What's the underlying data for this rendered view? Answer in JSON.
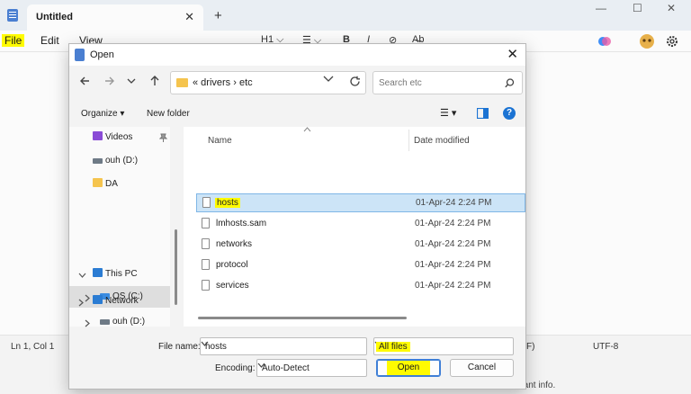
{
  "notepad": {
    "tab_title": "Untitled",
    "tab_close": "✕",
    "tab_add": "+",
    "window_controls": {
      "minimize": "—",
      "maximize": "☐",
      "close": "✕"
    },
    "menu": {
      "file": "File",
      "edit": "Edit",
      "view": "View"
    },
    "format_bar": {
      "heading": "H1 ⌵",
      "list": "☰ ⌵",
      "bold": "B",
      "italic": "I",
      "link": "⊘",
      "clear": "A̶b"
    },
    "status": {
      "position": "Ln 1, Col 1",
      "line_ending": "F)",
      "encoding": "UTF-8"
    },
    "info_text": "ortant info."
  },
  "dialog": {
    "title": "Open",
    "close": "✕",
    "address": {
      "path": "«  drivers  ›  etc"
    },
    "search": {
      "placeholder": "Search etc"
    },
    "toolbar": {
      "organize": "Organize ▾",
      "new_folder": "New folder",
      "view_toggle": "☰ ▾",
      "help": "?"
    },
    "nav_pane": {
      "videos": "Videos",
      "ouh_d_1": "ouh (D:)",
      "da": "DA",
      "this_pc": "This PC",
      "os_c": "OS (C:)",
      "ouh_d_2": "ouh (D:)",
      "network": "Network"
    },
    "columns": {
      "name": "Name",
      "date_modified": "Date modified"
    },
    "files": [
      {
        "name": "hosts",
        "date": "01-Apr-24 2:24 PM"
      },
      {
        "name": "lmhosts.sam",
        "date": "01-Apr-24 2:24 PM"
      },
      {
        "name": "networks",
        "date": "01-Apr-24 2:24 PM"
      },
      {
        "name": "protocol",
        "date": "01-Apr-24 2:24 PM"
      },
      {
        "name": "services",
        "date": "01-Apr-24 2:24 PM"
      }
    ],
    "bottom": {
      "file_name_label": "File name:",
      "file_name_value": "hosts",
      "filter_value": "All files",
      "encoding_label": "Encoding:",
      "encoding_value": "Auto-Detect",
      "open_label": "Open",
      "cancel_label": "Cancel"
    }
  },
  "colors": {
    "highlight": "#fffb00",
    "selection": "#cce4f7",
    "accent": "#1b73d3"
  }
}
